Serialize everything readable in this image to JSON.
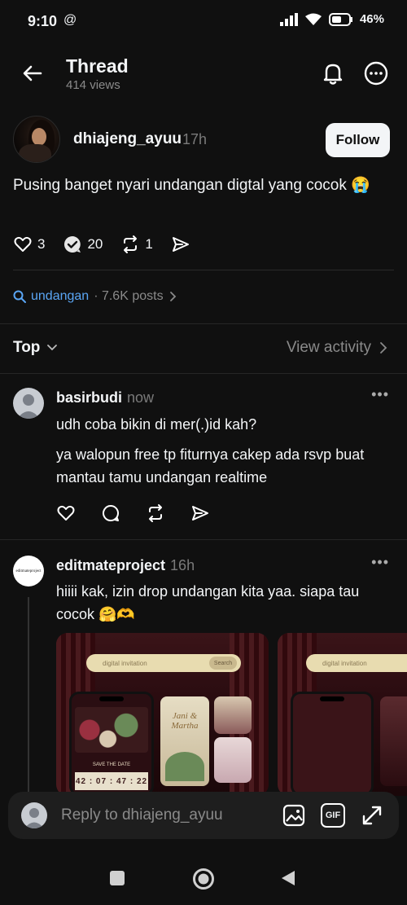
{
  "status": {
    "time": "9:10",
    "threads_glyph": "@",
    "battery": "46%"
  },
  "header": {
    "title": "Thread",
    "views": "414 views"
  },
  "post": {
    "username": "dhiajeng_ayuu",
    "time": "17h",
    "follow_label": "Follow",
    "text": "Pusing banget nyari undangan digtal yang cocok 😭",
    "likes": "3",
    "replies": "20",
    "reposts": "1"
  },
  "topic": {
    "tag": "undangan",
    "count": "· 7.6K posts"
  },
  "sort": {
    "label": "Top",
    "view_activity": "View activity"
  },
  "replies": [
    {
      "username": "basirbudi",
      "time": "now",
      "line1": "udh coba bikin di mer(.)id kah?",
      "line2": "ya walopun free tp fiturnya cakep ada rsvp buat mantau tamu undangan realtime"
    },
    {
      "username": "editmateproject",
      "time": "16h",
      "avatar_text": "editmateproject",
      "text": "hiiii kak, izin drop undangan kita yaa. siapa tau cocok 🤗🫶"
    }
  ],
  "media": {
    "search_text": "digital invitation",
    "search_button": "Search",
    "countdown": "42 : 07 : 47 : 22",
    "card_name": "Jani & Martha",
    "save_date": "SAVE THE DATE"
  },
  "compose": {
    "placeholder": "Reply to dhiajeng_ayuu",
    "gif_label": "GIF"
  },
  "colors": {
    "background": "#101010",
    "link": "#5aa6f5",
    "muted": "#8a8a8a"
  }
}
